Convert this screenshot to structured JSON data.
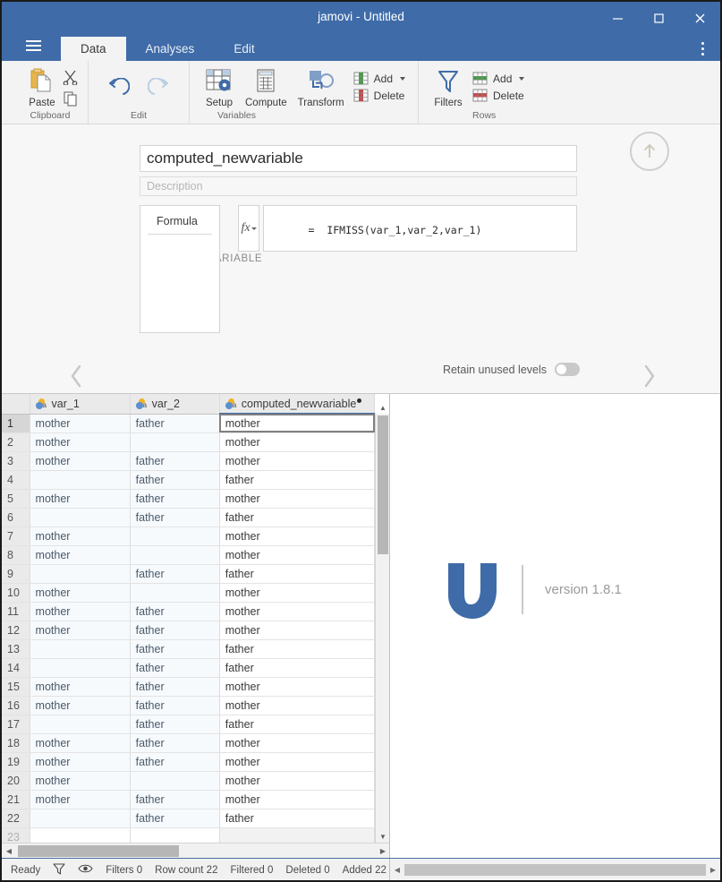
{
  "window": {
    "title": "jamovi - Untitled",
    "minimize_label": "minimize",
    "maximize_label": "maximize",
    "close_label": "close"
  },
  "tabs": [
    {
      "label": "Data",
      "active": true
    },
    {
      "label": "Analyses",
      "active": false
    },
    {
      "label": "Edit",
      "active": false
    }
  ],
  "ribbon": {
    "groups": [
      {
        "label": "Clipboard",
        "buttons": [
          {
            "label": "Paste",
            "icon": "paste-icon"
          },
          {
            "label": "",
            "icon": "cut-icon"
          },
          {
            "label": "",
            "icon": "copy-icon"
          }
        ]
      },
      {
        "label": "Edit",
        "buttons": [
          {
            "label": "",
            "icon": "undo-icon"
          },
          {
            "label": "",
            "icon": "redo-icon"
          }
        ]
      },
      {
        "label": "Variables",
        "buttons": [
          {
            "label": "Setup",
            "icon": "setup-icon"
          },
          {
            "label": "Compute",
            "icon": "compute-icon"
          },
          {
            "label": "Transform",
            "icon": "transform-icon"
          },
          {
            "label": "Add",
            "icon": "add-variable-icon"
          },
          {
            "label": "Delete",
            "icon": "delete-variable-icon"
          }
        ]
      },
      {
        "label": "Rows",
        "buttons": [
          {
            "label": "Filters",
            "icon": "filter-icon"
          },
          {
            "label": "Add",
            "icon": "add-row-icon"
          },
          {
            "label": "Delete",
            "icon": "delete-row-icon"
          }
        ]
      }
    ]
  },
  "editor": {
    "section_label": "COMPUTED VARIABLE",
    "variable_name": "computed_newvariable",
    "description_placeholder": "Description",
    "formula_tab_label": "Formula",
    "fx_label": "fx",
    "formula_value": "=  IFMISS(var_1,var_2,var_1)",
    "retain_label": "Retain unused levels",
    "retain_on": false,
    "prev_label": "previous variable",
    "next_label": "next variable",
    "collapse_label": "collapse editor"
  },
  "spreadsheet": {
    "columns": [
      {
        "name": "var_1",
        "type_icon": "nominal-text-icon",
        "selected": false,
        "modified": false
      },
      {
        "name": "var_2",
        "type_icon": "nominal-text-icon",
        "selected": false,
        "modified": false
      },
      {
        "name": "computed_newvariable",
        "type_icon": "nominal-text-icon",
        "selected": true,
        "modified": true
      }
    ],
    "rows": [
      {
        "n": "1",
        "cells": [
          "mother",
          "father",
          "mother"
        ]
      },
      {
        "n": "2",
        "cells": [
          "mother",
          "",
          "mother"
        ]
      },
      {
        "n": "3",
        "cells": [
          "mother",
          "father",
          "mother"
        ]
      },
      {
        "n": "4",
        "cells": [
          "",
          "father",
          "father"
        ]
      },
      {
        "n": "5",
        "cells": [
          "mother",
          "father",
          "mother"
        ]
      },
      {
        "n": "6",
        "cells": [
          "",
          "father",
          "father"
        ]
      },
      {
        "n": "7",
        "cells": [
          "mother",
          "",
          "mother"
        ]
      },
      {
        "n": "8",
        "cells": [
          "mother",
          "",
          "mother"
        ]
      },
      {
        "n": "9",
        "cells": [
          "",
          "father",
          "father"
        ]
      },
      {
        "n": "10",
        "cells": [
          "mother",
          "",
          "mother"
        ]
      },
      {
        "n": "11",
        "cells": [
          "mother",
          "father",
          "mother"
        ]
      },
      {
        "n": "12",
        "cells": [
          "mother",
          "father",
          "mother"
        ]
      },
      {
        "n": "13",
        "cells": [
          "",
          "father",
          "father"
        ]
      },
      {
        "n": "14",
        "cells": [
          "",
          "father",
          "father"
        ]
      },
      {
        "n": "15",
        "cells": [
          "mother",
          "father",
          "mother"
        ]
      },
      {
        "n": "16",
        "cells": [
          "mother",
          "father",
          "mother"
        ]
      },
      {
        "n": "17",
        "cells": [
          "",
          "father",
          "father"
        ]
      },
      {
        "n": "18",
        "cells": [
          "mother",
          "father",
          "mother"
        ]
      },
      {
        "n": "19",
        "cells": [
          "mother",
          "father",
          "mother"
        ]
      },
      {
        "n": "20",
        "cells": [
          "mother",
          "",
          "mother"
        ]
      },
      {
        "n": "21",
        "cells": [
          "mother",
          "father",
          "mother"
        ]
      },
      {
        "n": "22",
        "cells": [
          "",
          "father",
          "father"
        ]
      },
      {
        "n": "23",
        "cells": [
          "",
          "",
          ""
        ]
      }
    ]
  },
  "results": {
    "logo_glyph": "ν",
    "version": "version 1.8.1"
  },
  "statusbar": {
    "status": "Ready",
    "filter_icon": "funnel-icon",
    "eye_icon": "eye-icon",
    "items": [
      {
        "label": "Filters 0"
      },
      {
        "label": "Row count 22"
      },
      {
        "label": "Filtered 0"
      },
      {
        "label": "Deleted 0"
      },
      {
        "label": "Added 22"
      }
    ]
  },
  "colors": {
    "titlebar": "#3f6ca8",
    "accent": "#3f6ca8",
    "ribbon_bg": "#f3f3f3",
    "editor_bg": "#f7f7f7",
    "cell_bg": "#f7fafd",
    "logo_blue": "#3f6ca8"
  }
}
